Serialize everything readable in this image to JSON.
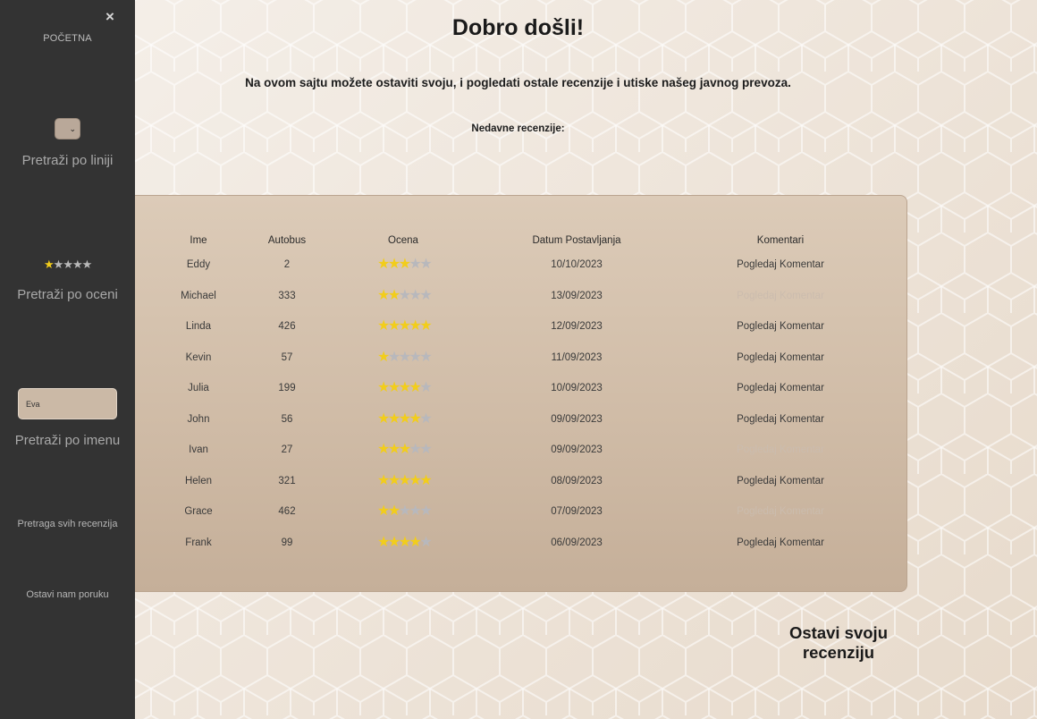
{
  "sidebar": {
    "close": "×",
    "home": "POČETNA",
    "line_search_label": "Pretraži po liniji",
    "rating_search_label": "Pretraži po oceni",
    "rating_search_stars": 1,
    "name_input_value": "Eva",
    "name_search_label": "Pretraži po imenu",
    "all_reviews": "Pretraga svih recenzija",
    "leave_message": "Ostavi nam poruku"
  },
  "main": {
    "title": "Dobro došli!",
    "intro": "Na ovom sajtu možete ostaviti svoju, i pogledati ostale recenzije i utiske našeg javnog prevoza.",
    "recent_label": "Nedavne recenzije:",
    "leave_review": "Ostavi svoju recenziju"
  },
  "table": {
    "headers": [
      "Ime",
      "Autobus",
      "Ocena",
      "Datum Postavljanja",
      "Komentari"
    ],
    "rows": [
      {
        "name": "Eddy",
        "bus": "2",
        "rating": 3,
        "date": "10/10/2023",
        "comment": "Pogledaj Komentar",
        "comment_faded": false
      },
      {
        "name": "Michael",
        "bus": "333",
        "rating": 2,
        "date": "13/09/2023",
        "comment": "Pogledaj Komentar",
        "comment_faded": true
      },
      {
        "name": "Linda",
        "bus": "426",
        "rating": 5,
        "date": "12/09/2023",
        "comment": "Pogledaj Komentar",
        "comment_faded": false
      },
      {
        "name": "Kevin",
        "bus": "57",
        "rating": 1,
        "date": "11/09/2023",
        "comment": "Pogledaj Komentar",
        "comment_faded": false
      },
      {
        "name": "Julia",
        "bus": "199",
        "rating": 4,
        "date": "10/09/2023",
        "comment": "Pogledaj Komentar",
        "comment_faded": false
      },
      {
        "name": "John",
        "bus": "56",
        "rating": 4,
        "date": "09/09/2023",
        "comment": "Pogledaj Komentar",
        "comment_faded": false
      },
      {
        "name": "Ivan",
        "bus": "27",
        "rating": 3,
        "date": "09/09/2023",
        "comment": "Pogledaj Komentar",
        "comment_faded": true
      },
      {
        "name": "Helen",
        "bus": "321",
        "rating": 5,
        "date": "08/09/2023",
        "comment": "Pogledaj Komentar",
        "comment_faded": false
      },
      {
        "name": "Grace",
        "bus": "462",
        "rating": 2,
        "date": "07/09/2023",
        "comment": "Pogledaj Komentar",
        "comment_faded": true
      },
      {
        "name": "Frank",
        "bus": "99",
        "rating": 4,
        "date": "06/09/2023",
        "comment": "Pogledaj Komentar",
        "comment_faded": false
      }
    ]
  },
  "colors": {
    "sidebar_bg": "#333333",
    "star_on": "#f2cd1b",
    "star_off": "#b8b8bc",
    "panel_bg": "#d6c4b0"
  }
}
